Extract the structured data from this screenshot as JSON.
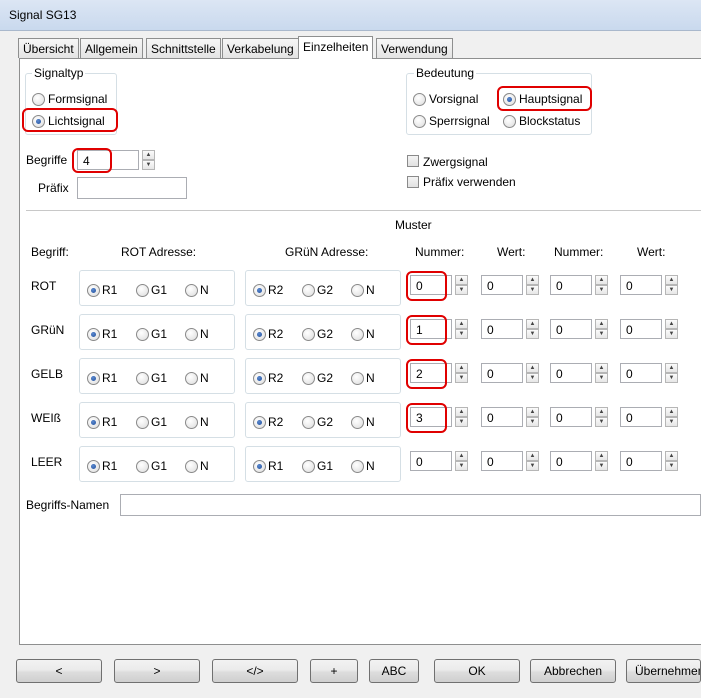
{
  "window": {
    "title": "Signal SG13"
  },
  "tabs": [
    {
      "label": "Übersicht"
    },
    {
      "label": "Allgemein"
    },
    {
      "label": "Schnittstelle"
    },
    {
      "label": "Verkabelung"
    },
    {
      "label": "Einzelheiten",
      "active": true
    },
    {
      "label": "Verwendung"
    }
  ],
  "signaltyp": {
    "legend": "Signaltyp",
    "options": [
      "Formsignal",
      "Lichtsignal"
    ],
    "selected": "Lichtsignal"
  },
  "bedeutung": {
    "legend": "Bedeutung",
    "options": [
      "Vorsignal",
      "Hauptsignal",
      "Sperrsignal",
      "Blockstatus"
    ],
    "selected": "Hauptsignal"
  },
  "begriffe": {
    "label": "Begriffe",
    "value": "4"
  },
  "praefix": {
    "label": "Präfix",
    "value": ""
  },
  "zwergsignal": {
    "label": "Zwergsignal",
    "checked": false
  },
  "praefix_verwenden": {
    "label": "Präfix verwenden",
    "checked": false
  },
  "muster": {
    "title": "Muster",
    "headers": {
      "begriff": "Begriff:",
      "rot": "ROT Adresse:",
      "gruen": "GRüN Adresse:",
      "nummer1": "Nummer:",
      "wert1": "Wert:",
      "nummer2": "Nummer:",
      "wert2": "Wert:"
    },
    "rows": [
      {
        "name": "ROT",
        "rot": [
          "R1",
          "G1",
          "N"
        ],
        "rot_sel": "R1",
        "gruen": [
          "R2",
          "G2",
          "N"
        ],
        "gruen_sel": "R2",
        "values": [
          "0",
          "0",
          "0",
          "0"
        ]
      },
      {
        "name": "GRüN",
        "rot": [
          "R1",
          "G1",
          "N"
        ],
        "rot_sel": "R1",
        "gruen": [
          "R2",
          "G2",
          "N"
        ],
        "gruen_sel": "R2",
        "values": [
          "1",
          "0",
          "0",
          "0"
        ]
      },
      {
        "name": "GELB",
        "rot": [
          "R1",
          "G1",
          "N"
        ],
        "rot_sel": "R1",
        "gruen": [
          "R2",
          "G2",
          "N"
        ],
        "gruen_sel": "R2",
        "values": [
          "2",
          "0",
          "0",
          "0"
        ]
      },
      {
        "name": "WEIß",
        "rot": [
          "R1",
          "G1",
          "N"
        ],
        "rot_sel": "R1",
        "gruen": [
          "R2",
          "G2",
          "N"
        ],
        "gruen_sel": "R2",
        "values": [
          "3",
          "0",
          "0",
          "0"
        ]
      },
      {
        "name": "LEER",
        "rot": [
          "R1",
          "G1",
          "N"
        ],
        "rot_sel": "R1",
        "gruen": [
          "R1",
          "G1",
          "N"
        ],
        "gruen_sel": "R1",
        "values": [
          "0",
          "0",
          "0",
          "0"
        ]
      }
    ]
  },
  "begriffs_namen": {
    "label": "Begriffs-Namen",
    "value": ""
  },
  "buttons": [
    "<",
    ">",
    "</>",
    "+",
    "ABC",
    "OK",
    "Abbrechen",
    "Übernehmen"
  ],
  "colors": {
    "highlight": "#e00000",
    "radio_dot": "#1f4e9a",
    "title_bar": "#dce6f4"
  }
}
